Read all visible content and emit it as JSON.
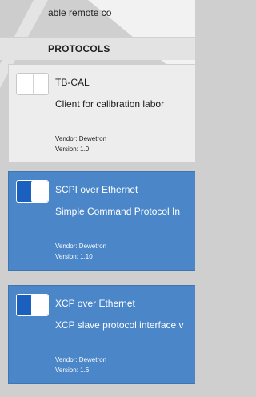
{
  "header": {
    "partial_text": "able remote co",
    "section_title": "PROTOCOLS"
  },
  "protocols": [
    {
      "name": "TB-CAL",
      "description": "Client for calibration labor",
      "vendor": "Vendor: Dewetron",
      "version": "Version: 1.0",
      "enabled": false
    },
    {
      "name": "SCPI over Ethernet",
      "description": "Simple Command Protocol In",
      "vendor": "Vendor: Dewetron",
      "version": "Version: 1.10",
      "enabled": true
    },
    {
      "name": "XCP over Ethernet",
      "description": "XCP slave protocol interface v",
      "vendor": "Vendor: Dewetron",
      "version": "Version: 1.6",
      "enabled": true
    }
  ],
  "colors": {
    "active_card": "#4a86c8",
    "inactive_card": "#ededed",
    "toggle_on": "#1b5fbf",
    "background": "#cfcfcf"
  }
}
